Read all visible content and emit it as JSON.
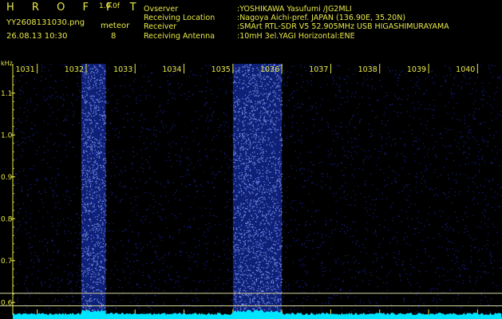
{
  "header": {
    "title": "H R O F F T",
    "version": "1.0.0f",
    "filename": "YY2608131030.png",
    "datetime": "26.08.13 10:30",
    "meteor_label": "meteor",
    "meteor_count": "8"
  },
  "info": [
    {
      "label": "Ovserver",
      "value": ":YOSHIKAWA Yasufumi /JG2MLI"
    },
    {
      "label": "Receiving Location",
      "value": ":Nagoya Aichi-pref. JAPAN (136.90E, 35.20N)"
    },
    {
      "label": "Receiver",
      "value": ":SMArt RTL-SDR V5 52.905MHz USB HIGASHIMURAYAMA"
    },
    {
      "label": "Receiving Antenna",
      "value": ":10mH 3el.YAGI Horizontal:ENE"
    }
  ],
  "axes": {
    "y_unit": "kHz",
    "y_ticks": [
      "1.1",
      "1.0",
      "0.9",
      "0.8",
      "0.7",
      "0.6"
    ],
    "x_ticks": [
      "1031",
      "1032",
      "1033",
      "1034",
      "1035",
      "1036",
      "1037",
      "1038",
      "1039",
      "1040"
    ]
  },
  "spectrogram": {
    "type": "heatmap",
    "x_range": [
      1030.5,
      1040.5
    ],
    "y_range": [
      0.57,
      1.17
    ],
    "bright_bands": [
      [
        1031.9,
        1032.4
      ],
      [
        1035.0,
        1036.0
      ]
    ],
    "colors": {
      "background": "#000000",
      "noise": "#1a2bb0",
      "text": "#e8e84a",
      "baseline": "#00e5ff"
    }
  }
}
